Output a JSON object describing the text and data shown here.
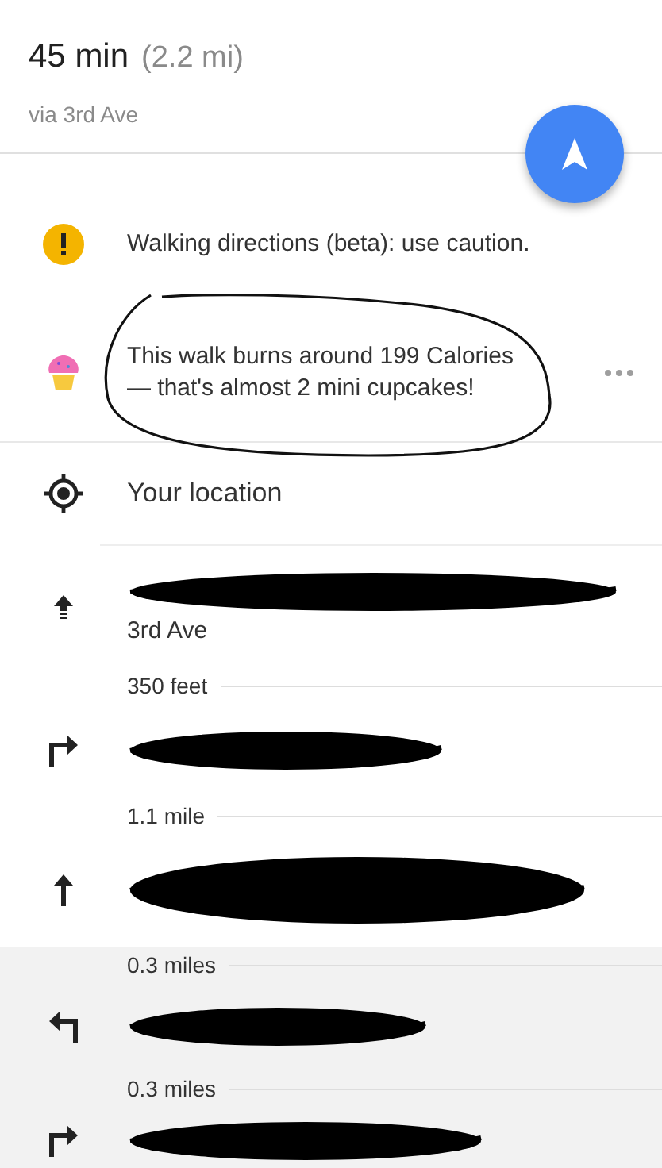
{
  "summary": {
    "duration": "45 min",
    "distance": "(2.2 mi)",
    "via": "via 3rd Ave"
  },
  "notices": [
    {
      "kind": "warning",
      "text": "Walking directions (beta): use caution.",
      "circled": false,
      "more": false
    },
    {
      "kind": "calories",
      "text": "This walk burns around 199 Calories — that's almost 2 mini cupcakes!",
      "circled": true,
      "more": true
    }
  ],
  "origin": {
    "label": "Your location"
  },
  "steps": [
    {
      "kind": "head",
      "redacted": true,
      "street": "3rd Ave",
      "distance": "350 feet",
      "highlighted": false
    },
    {
      "kind": "right",
      "redacted": true,
      "distance": "1.1 mile",
      "highlighted": false
    },
    {
      "kind": "straight",
      "redacted": true,
      "distance": "0.3 miles",
      "highlighted": false
    },
    {
      "kind": "left",
      "redacted": true,
      "distance": "0.3 miles",
      "highlighted": true
    },
    {
      "kind": "right",
      "redacted": true,
      "highlighted": true
    }
  ]
}
